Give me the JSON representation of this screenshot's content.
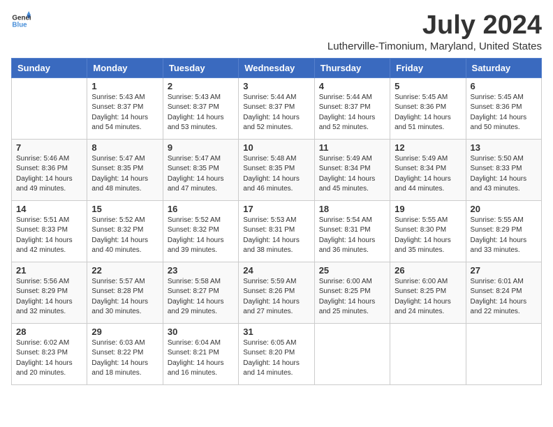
{
  "logo": {
    "text_general": "General",
    "text_blue": "Blue"
  },
  "title": "July 2024",
  "subtitle": "Lutherville-Timonium, Maryland, United States",
  "headers": [
    "Sunday",
    "Monday",
    "Tuesday",
    "Wednesday",
    "Thursday",
    "Friday",
    "Saturday"
  ],
  "weeks": [
    [
      {
        "day": "",
        "info": ""
      },
      {
        "day": "1",
        "info": "Sunrise: 5:43 AM\nSunset: 8:37 PM\nDaylight: 14 hours\nand 54 minutes."
      },
      {
        "day": "2",
        "info": "Sunrise: 5:43 AM\nSunset: 8:37 PM\nDaylight: 14 hours\nand 53 minutes."
      },
      {
        "day": "3",
        "info": "Sunrise: 5:44 AM\nSunset: 8:37 PM\nDaylight: 14 hours\nand 52 minutes."
      },
      {
        "day": "4",
        "info": "Sunrise: 5:44 AM\nSunset: 8:37 PM\nDaylight: 14 hours\nand 52 minutes."
      },
      {
        "day": "5",
        "info": "Sunrise: 5:45 AM\nSunset: 8:36 PM\nDaylight: 14 hours\nand 51 minutes."
      },
      {
        "day": "6",
        "info": "Sunrise: 5:45 AM\nSunset: 8:36 PM\nDaylight: 14 hours\nand 50 minutes."
      }
    ],
    [
      {
        "day": "7",
        "info": "Sunrise: 5:46 AM\nSunset: 8:36 PM\nDaylight: 14 hours\nand 49 minutes."
      },
      {
        "day": "8",
        "info": "Sunrise: 5:47 AM\nSunset: 8:35 PM\nDaylight: 14 hours\nand 48 minutes."
      },
      {
        "day": "9",
        "info": "Sunrise: 5:47 AM\nSunset: 8:35 PM\nDaylight: 14 hours\nand 47 minutes."
      },
      {
        "day": "10",
        "info": "Sunrise: 5:48 AM\nSunset: 8:35 PM\nDaylight: 14 hours\nand 46 minutes."
      },
      {
        "day": "11",
        "info": "Sunrise: 5:49 AM\nSunset: 8:34 PM\nDaylight: 14 hours\nand 45 minutes."
      },
      {
        "day": "12",
        "info": "Sunrise: 5:49 AM\nSunset: 8:34 PM\nDaylight: 14 hours\nand 44 minutes."
      },
      {
        "day": "13",
        "info": "Sunrise: 5:50 AM\nSunset: 8:33 PM\nDaylight: 14 hours\nand 43 minutes."
      }
    ],
    [
      {
        "day": "14",
        "info": "Sunrise: 5:51 AM\nSunset: 8:33 PM\nDaylight: 14 hours\nand 42 minutes."
      },
      {
        "day": "15",
        "info": "Sunrise: 5:52 AM\nSunset: 8:32 PM\nDaylight: 14 hours\nand 40 minutes."
      },
      {
        "day": "16",
        "info": "Sunrise: 5:52 AM\nSunset: 8:32 PM\nDaylight: 14 hours\nand 39 minutes."
      },
      {
        "day": "17",
        "info": "Sunrise: 5:53 AM\nSunset: 8:31 PM\nDaylight: 14 hours\nand 38 minutes."
      },
      {
        "day": "18",
        "info": "Sunrise: 5:54 AM\nSunset: 8:31 PM\nDaylight: 14 hours\nand 36 minutes."
      },
      {
        "day": "19",
        "info": "Sunrise: 5:55 AM\nSunset: 8:30 PM\nDaylight: 14 hours\nand 35 minutes."
      },
      {
        "day": "20",
        "info": "Sunrise: 5:55 AM\nSunset: 8:29 PM\nDaylight: 14 hours\nand 33 minutes."
      }
    ],
    [
      {
        "day": "21",
        "info": "Sunrise: 5:56 AM\nSunset: 8:29 PM\nDaylight: 14 hours\nand 32 minutes."
      },
      {
        "day": "22",
        "info": "Sunrise: 5:57 AM\nSunset: 8:28 PM\nDaylight: 14 hours\nand 30 minutes."
      },
      {
        "day": "23",
        "info": "Sunrise: 5:58 AM\nSunset: 8:27 PM\nDaylight: 14 hours\nand 29 minutes."
      },
      {
        "day": "24",
        "info": "Sunrise: 5:59 AM\nSunset: 8:26 PM\nDaylight: 14 hours\nand 27 minutes."
      },
      {
        "day": "25",
        "info": "Sunrise: 6:00 AM\nSunset: 8:25 PM\nDaylight: 14 hours\nand 25 minutes."
      },
      {
        "day": "26",
        "info": "Sunrise: 6:00 AM\nSunset: 8:25 PM\nDaylight: 14 hours\nand 24 minutes."
      },
      {
        "day": "27",
        "info": "Sunrise: 6:01 AM\nSunset: 8:24 PM\nDaylight: 14 hours\nand 22 minutes."
      }
    ],
    [
      {
        "day": "28",
        "info": "Sunrise: 6:02 AM\nSunset: 8:23 PM\nDaylight: 14 hours\nand 20 minutes."
      },
      {
        "day": "29",
        "info": "Sunrise: 6:03 AM\nSunset: 8:22 PM\nDaylight: 14 hours\nand 18 minutes."
      },
      {
        "day": "30",
        "info": "Sunrise: 6:04 AM\nSunset: 8:21 PM\nDaylight: 14 hours\nand 16 minutes."
      },
      {
        "day": "31",
        "info": "Sunrise: 6:05 AM\nSunset: 8:20 PM\nDaylight: 14 hours\nand 14 minutes."
      },
      {
        "day": "",
        "info": ""
      },
      {
        "day": "",
        "info": ""
      },
      {
        "day": "",
        "info": ""
      }
    ]
  ]
}
